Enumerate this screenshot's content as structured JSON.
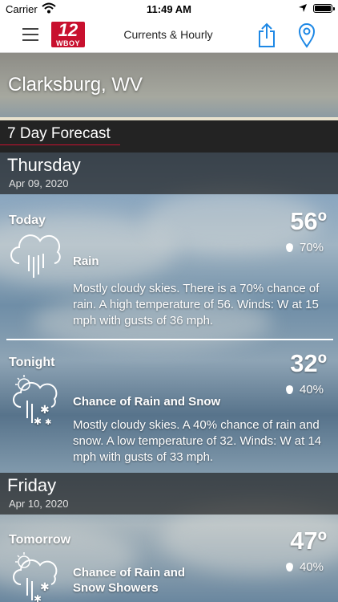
{
  "status_bar": {
    "carrier": "Carrier",
    "time": "11:49 AM"
  },
  "nav": {
    "title": "Currents & Hourly",
    "logo_number": "12",
    "logo_call": "WBOY"
  },
  "location": "Clarksburg, WV",
  "section_title": "7 Day Forecast",
  "days": [
    {
      "name": "Thursday",
      "date": "Apr 09, 2020",
      "periods": [
        {
          "name": "Today",
          "temp": "56º",
          "precip": "70%",
          "icon": "rain-icon",
          "condition": "Rain",
          "description": "Mostly cloudy skies. There is a 70% chance of rain.  A high temperature of 56.  Winds: W at 15 mph with gusts of 36 mph."
        },
        {
          "name": "Tonight",
          "temp": "32º",
          "precip": "40%",
          "icon": "rain-snow-icon",
          "condition": "Chance of Rain and Snow",
          "description": "Mostly cloudy skies.  A 40% chance of rain and snow.  A low temperature of 32.  Winds: W at 14 mph with gusts of 33 mph."
        }
      ]
    },
    {
      "name": "Friday",
      "date": "Apr 10, 2020",
      "periods": [
        {
          "name": "Tomorrow",
          "temp": "47º",
          "precip": "40%",
          "icon": "rain-snow-icon",
          "condition": "Chance of Rain and Snow Showers"
        }
      ]
    }
  ],
  "colors": {
    "accent_red": "#c8102e",
    "header_bg": "#232323",
    "nav_icon_blue": "#1e88e5"
  }
}
